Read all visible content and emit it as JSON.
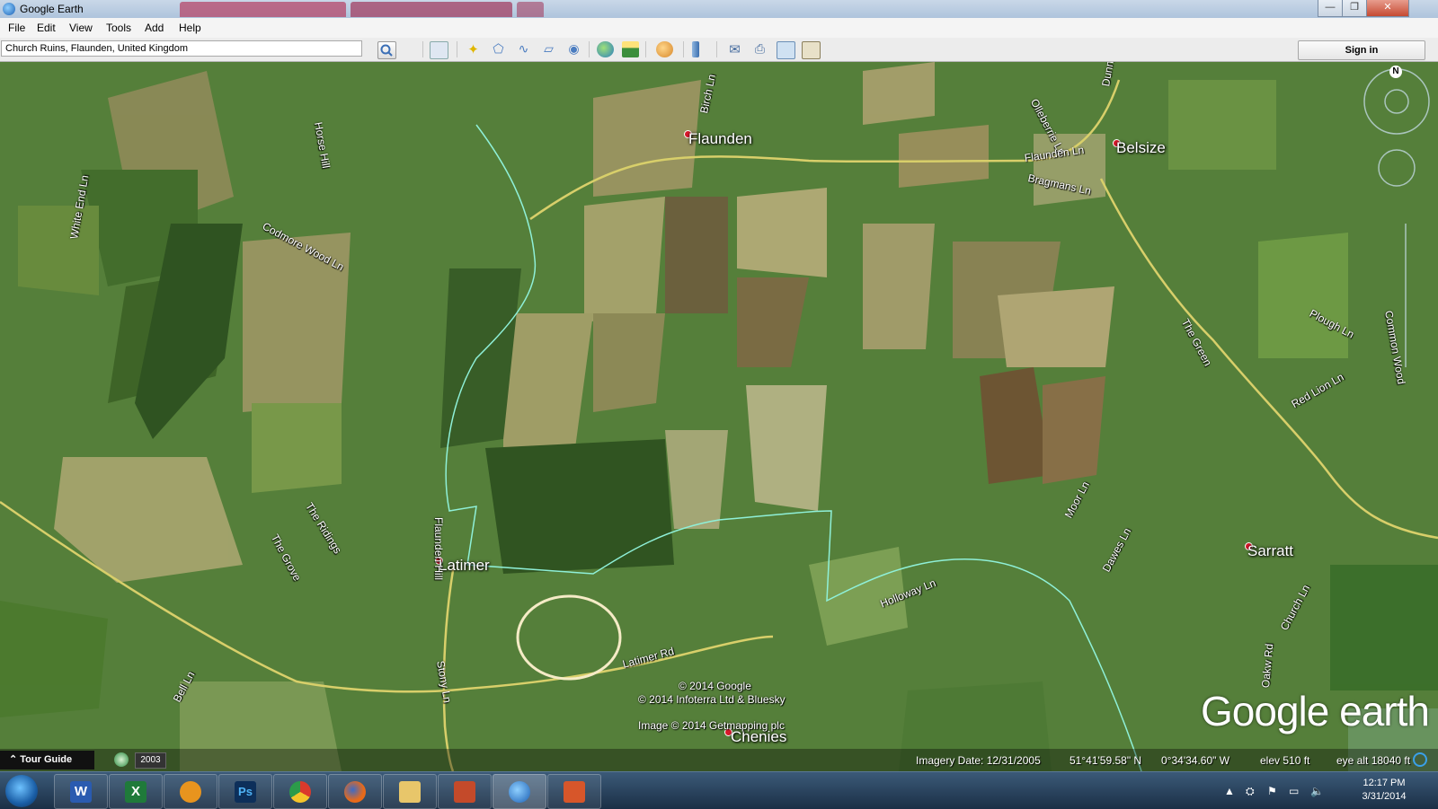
{
  "window": {
    "title": "Google Earth",
    "min": "—",
    "max": "❐",
    "close": "✕"
  },
  "menu": [
    "File",
    "Edit",
    "View",
    "Tools",
    "Add",
    "Help"
  ],
  "search": {
    "value": "Church Ruins, Flaunden, United Kingdom"
  },
  "toolbar": {
    "sign_in": "Sign in"
  },
  "map": {
    "towns": [
      "Flaunden",
      "Belsize",
      "Latimer",
      "Sarratt",
      "Chenies"
    ],
    "roads": [
      "Horse Hill",
      "Birch Ln",
      "Olleberrie Ln",
      "Dunny Ln",
      "Flaunden Ln",
      "Bragmans Ln",
      "Codmore Wood Ln",
      "White End Ln",
      "The Green",
      "Plough Ln",
      "Common Wood",
      "Red Lion Ln",
      "The Ridings",
      "The Grove",
      "Flaunden Hill",
      "Moor Ln",
      "Dawes Ln",
      "Holloway Ln",
      "Latimer Rd",
      "Stony Ln",
      "Bell Ln",
      "Church Ln",
      "Oakw Rd"
    ],
    "credits": [
      "© 2014 Google",
      "© 2014 Infoterra Ltd & Bluesky",
      "Image © 2014 Getmapping plc"
    ],
    "compass_north": "N"
  },
  "status": {
    "imagery_date": "Imagery Date: 12/31/2005",
    "lat": "51°41'59.58\" N",
    "lon": "0°34'34.60\" W",
    "elev": "elev   510 ft",
    "eye_alt": "eye alt  18040 ft",
    "tour_guide": "Tour Guide",
    "history_year": "2003"
  },
  "logo": "Google earth",
  "taskbar": {
    "apps": [
      "word",
      "excel",
      "sketch",
      "photoshop",
      "chrome",
      "firefox",
      "explorer",
      "app-paint",
      "google-earth",
      "app-folder"
    ],
    "time": "12:17 PM",
    "date": "3/31/2014"
  },
  "colors": {
    "accent_circle": "#f5ebc6",
    "road": "#d8cf6a",
    "boundary": "#8ff0d8"
  }
}
